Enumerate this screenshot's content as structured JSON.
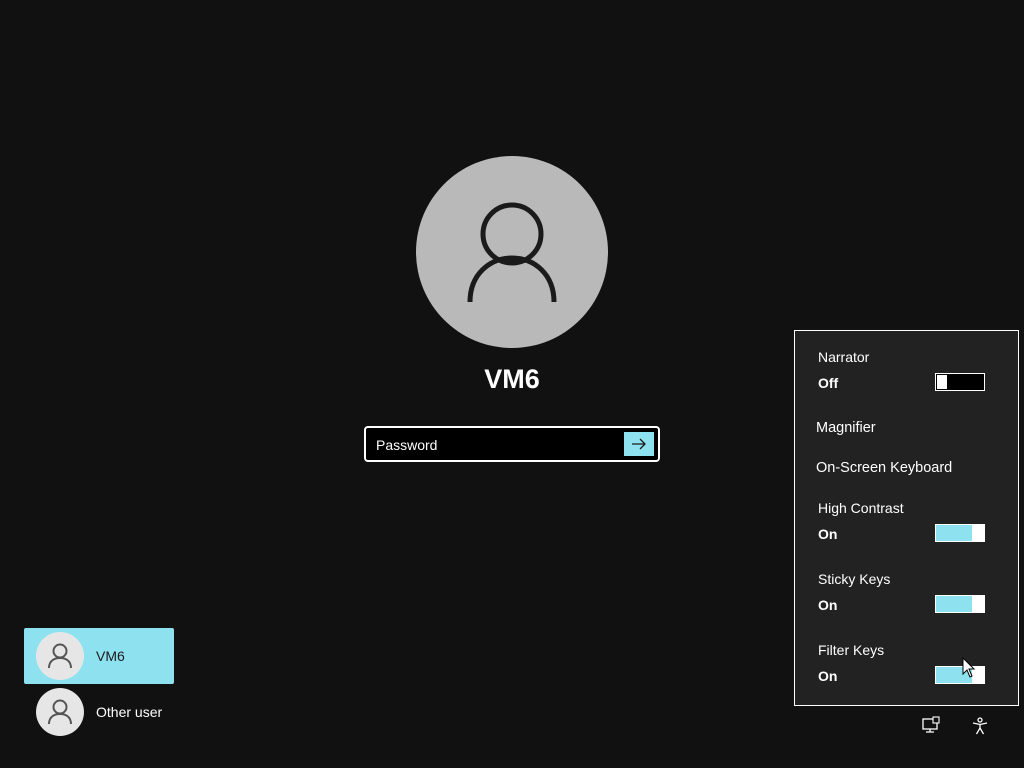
{
  "login": {
    "username": "VM6",
    "password_placeholder": "Password",
    "submit_icon": "arrow-right-icon"
  },
  "users": [
    {
      "name": "VM6",
      "selected": true,
      "icon": "user-icon"
    },
    {
      "name": "Other user",
      "selected": false,
      "icon": "user-icon"
    }
  ],
  "accessibility": {
    "narrator": {
      "label": "Narrator",
      "state": "Off",
      "on": false
    },
    "magnifier": {
      "label": "Magnifier"
    },
    "on_screen_keyboard": {
      "label": "On-Screen Keyboard"
    },
    "high_contrast": {
      "label": "High Contrast",
      "state": "On",
      "on": true
    },
    "sticky_keys": {
      "label": "Sticky Keys",
      "state": "On",
      "on": true
    },
    "filter_keys": {
      "label": "Filter Keys",
      "state": "On",
      "on": true
    }
  },
  "tray": {
    "network_icon": "network-icon",
    "accessibility_icon": "accessibility-icon"
  },
  "colors": {
    "background": "#111111",
    "accent": "#8ee2f0",
    "avatar": "#b9b9b9",
    "flyout": "#222222"
  }
}
